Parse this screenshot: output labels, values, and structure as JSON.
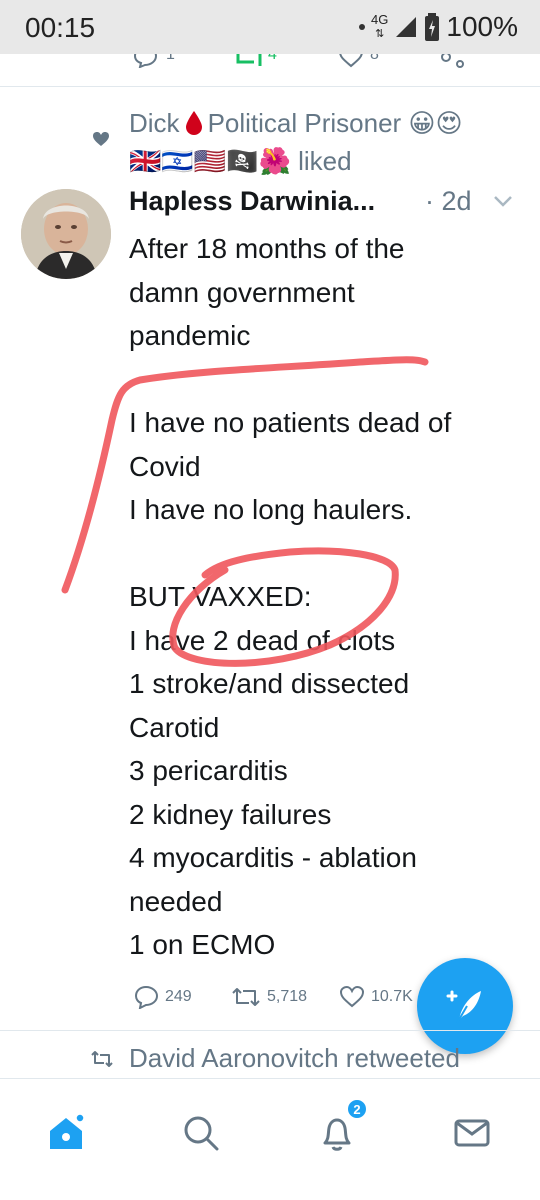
{
  "status_bar": {
    "time": "00:15",
    "network": "4G",
    "battery": "100%"
  },
  "prev_tweet": {
    "reply_count": "1",
    "retweet_count": "4",
    "like_count": "8"
  },
  "social_context": {
    "name": "Dick",
    "name_suffix": "Political Prisoner 😀😍",
    "flags_line": "🇬🇧🇮🇱🇺🇸🏴‍☠️🌺",
    "action": "liked"
  },
  "tweet": {
    "author": "Hapless Darwinia...",
    "time": "· 2d",
    "lines": [
      "After 18 months of the",
      "damn government",
      "pandemic",
      "",
      "I have no patients dead of",
      "Covid",
      "I have no long haulers.",
      "",
      "BUT VAXXED:",
      "I have 2 dead of clots",
      "1 stroke/and dissected",
      "Carotid",
      "3 pericarditis",
      "2 kidney failures",
      "4 myocarditis - ablation",
      "needed",
      "1 on ECMO"
    ],
    "reply_count": "249",
    "retweet_count": "5,718",
    "like_count": "10.7K"
  },
  "next_context": {
    "text": "David Aaronovitch retweeted"
  },
  "bottom_nav": {
    "notification_badge": "2"
  },
  "colors": {
    "accent": "#1da1f2",
    "scribble": "#f0575c",
    "secondary_text": "#657786"
  }
}
